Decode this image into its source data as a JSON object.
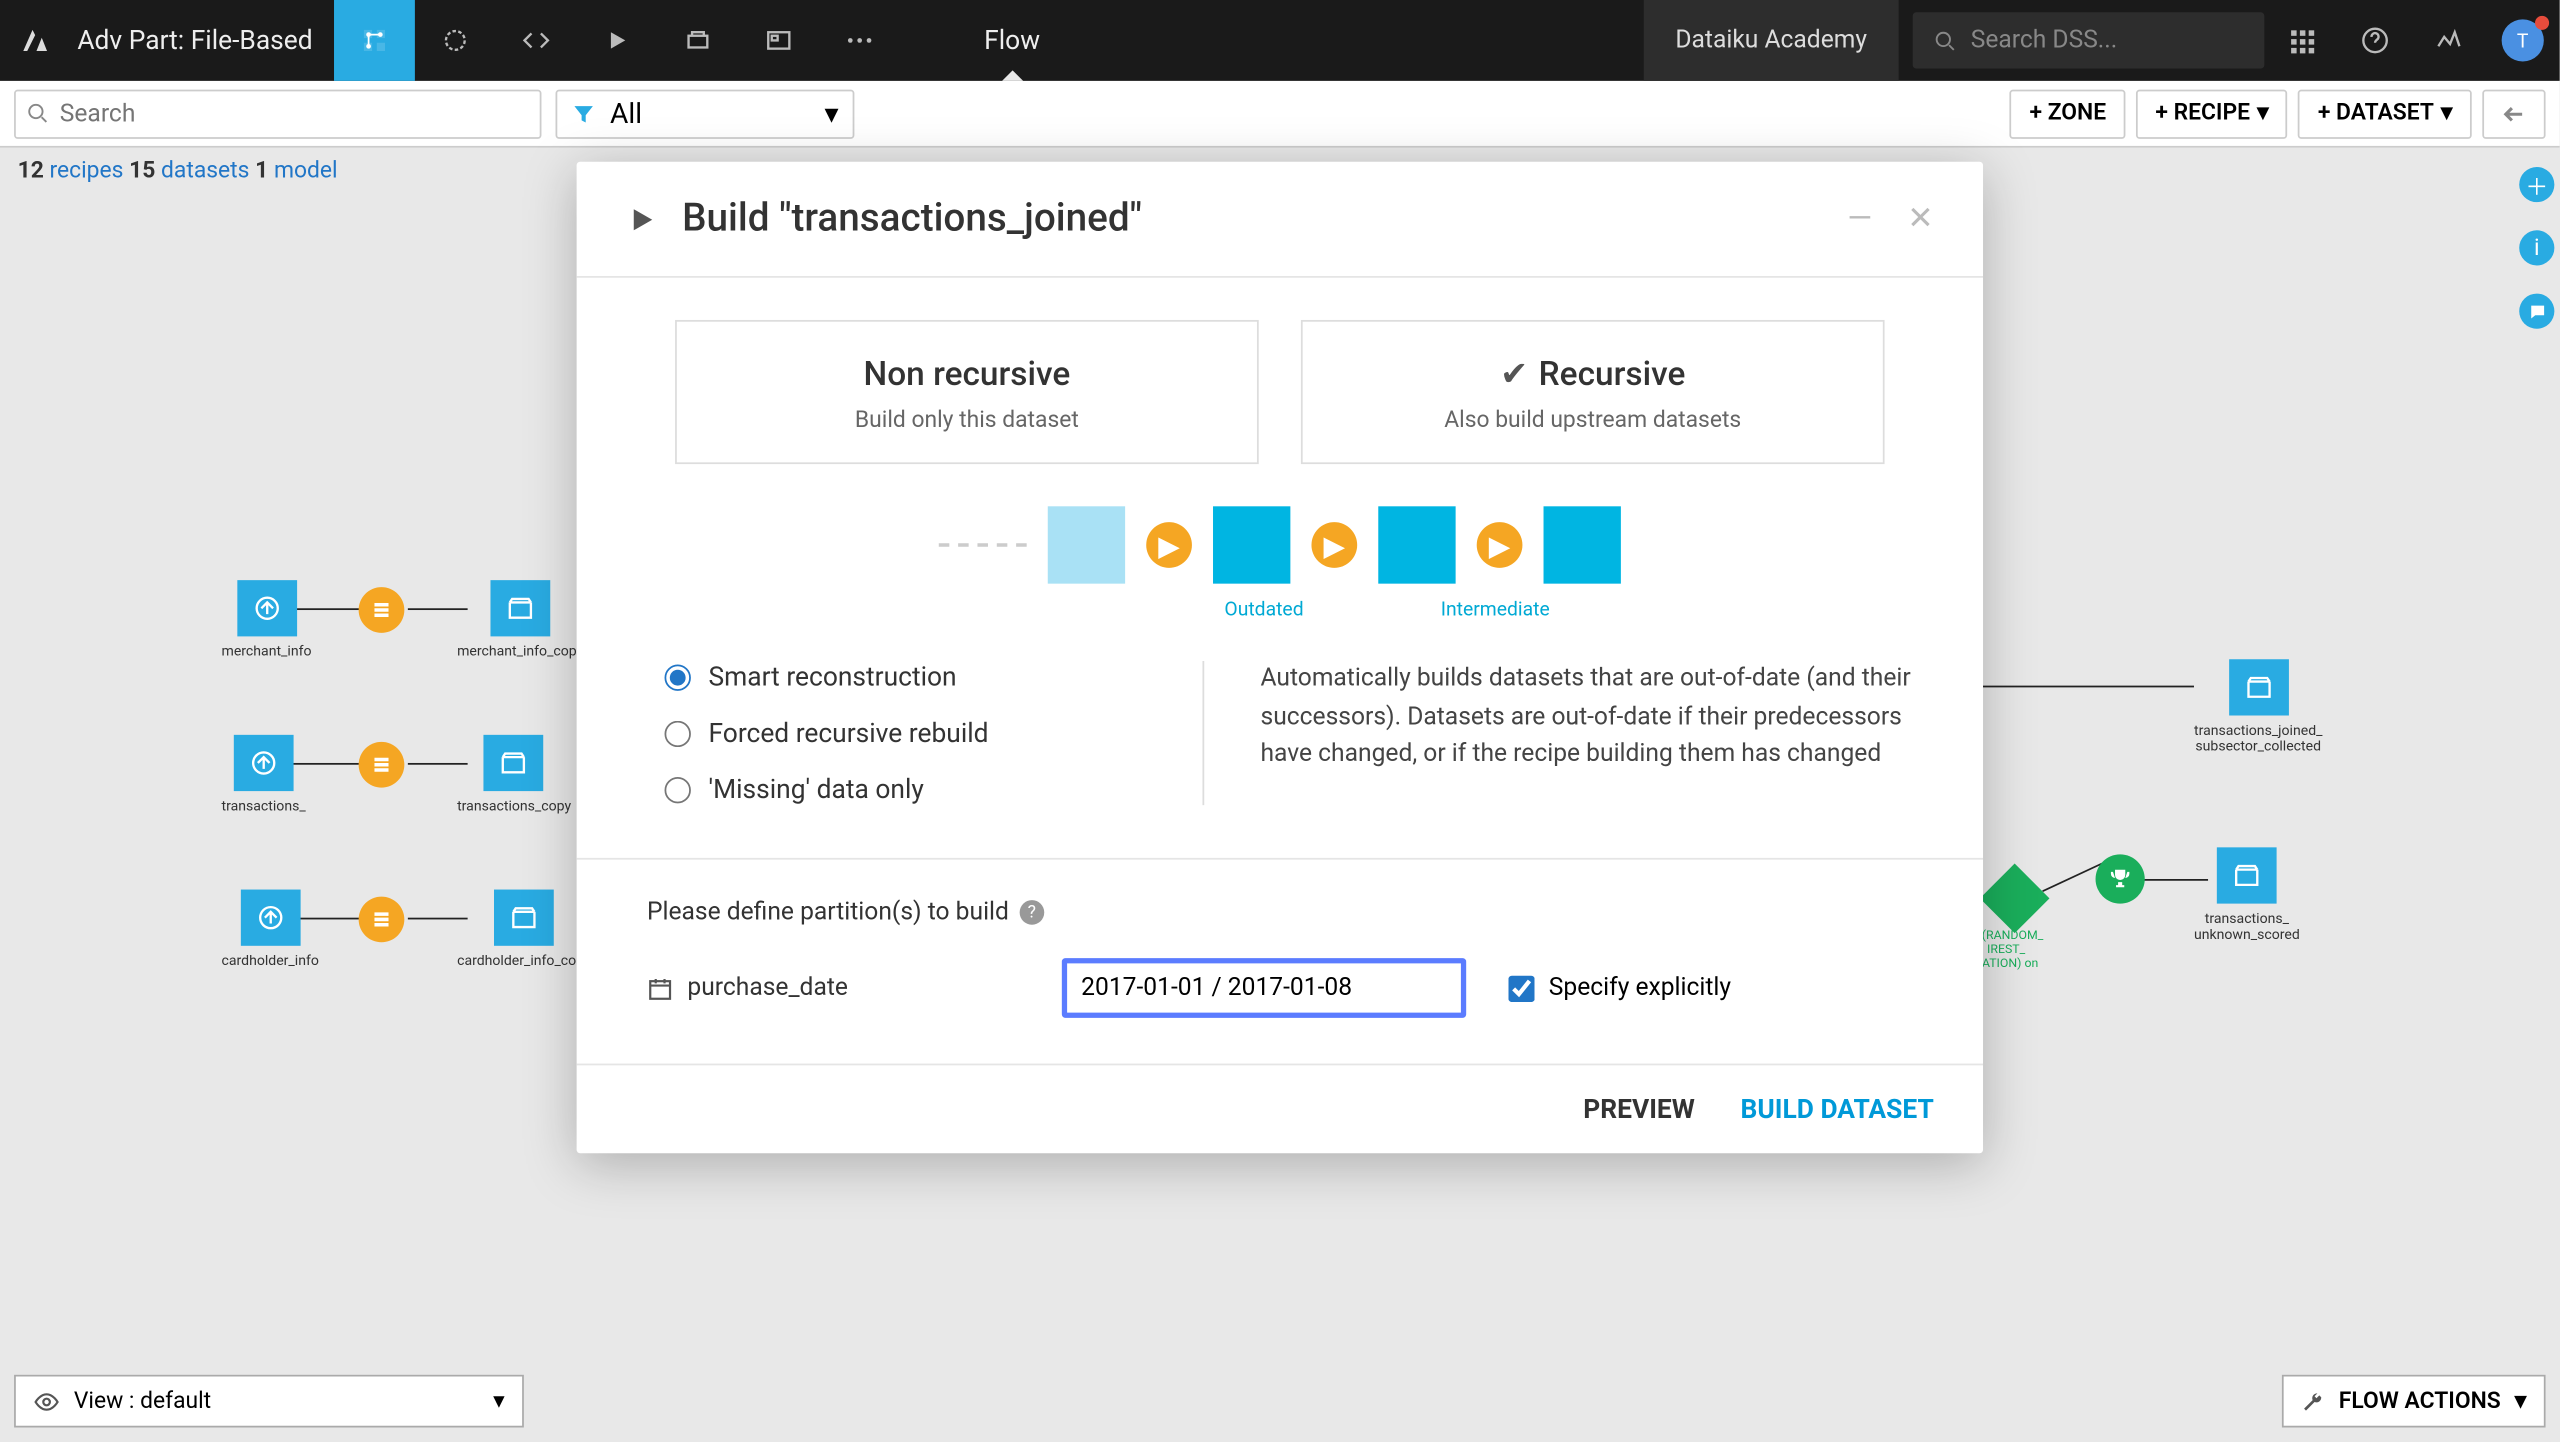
{
  "topbar": {
    "project_name": "Adv Part: File-Based",
    "flow_label": "Flow",
    "academy_label": "Dataiku Academy",
    "search_placeholder": "Search DSS...",
    "avatar_initial": "T"
  },
  "secbar": {
    "search_placeholder": "Search",
    "filter_label": "All",
    "zone_btn": "+ ZONE",
    "recipe_btn": "+ RECIPE",
    "dataset_btn": "+ DATASET"
  },
  "stats": {
    "recipes_count": "12",
    "recipes_label": "recipes",
    "datasets_count": "15",
    "datasets_label": "datasets",
    "models_count": "1",
    "models_label": "model"
  },
  "flow_nodes": {
    "merchant_info": "merchant_info",
    "merchant_info_copy": "merchant_info_copy",
    "transactions": "transactions_",
    "transactions_copy": "transactions_copy",
    "cardholder_info": "cardholder_info",
    "cardholder_info_copy": "cardholder_info_copy",
    "transactions_joined_subsector_collected": "transactions_joined_\nsubsector_collected",
    "transactions_unknown_scored": "transactions_\nunknown_scored",
    "model_label": "in (RANDOM_\nIREST_\nCATION) on"
  },
  "bottombar": {
    "view_label": "View : default",
    "flow_actions": "FLOW ACTIONS"
  },
  "modal": {
    "title": "Build \"transactions_joined\"",
    "modes": {
      "non_recursive": {
        "title": "Non recursive",
        "subtitle": "Build only this dataset"
      },
      "recursive": {
        "title": "Recursive",
        "subtitle": "Also build upstream datasets"
      }
    },
    "diagram_labels": {
      "outdated": "Outdated",
      "intermediate": "Intermediate"
    },
    "radio_options": {
      "smart": "Smart reconstruction",
      "forced": "Forced recursive rebuild",
      "missing": "'Missing' data only"
    },
    "option_desc": "Automatically builds datasets that are out-of-date (and their successors). Datasets are out-of-date if their predecessors have changed, or if the recipe building them has changed",
    "partition_title": "Please define partition(s) to build",
    "partition_dim": "purchase_date",
    "partition_value": "2017-01-01 / 2017-01-08",
    "specify_label": "Specify explicitly",
    "footer": {
      "preview": "PREVIEW",
      "build": "BUILD DATASET"
    }
  }
}
